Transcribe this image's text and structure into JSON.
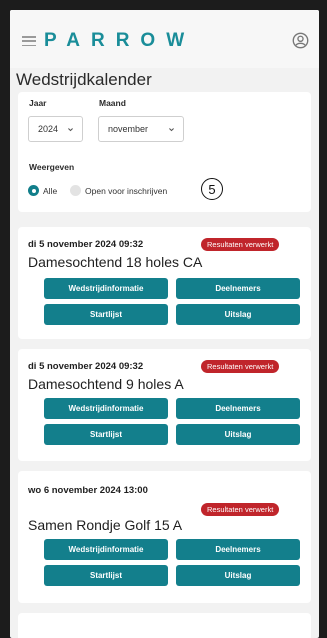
{
  "app": {
    "logo": "PARROW"
  },
  "page": {
    "title": "Wedstrijdkalender"
  },
  "filters": {
    "year_label": "Jaar",
    "year_value": "2024",
    "month_label": "Maand",
    "month_value": "november",
    "view_label": "Weergeven",
    "option_all": "Alle",
    "option_open": "Open voor inschrijven",
    "step_marker": "5"
  },
  "events": [
    {
      "date": "di 5 november 2024 09:32",
      "title": "Damesochtend 18 holes CA",
      "status": "Resultaten verwerkt",
      "buttons": [
        "Wedstrijdinformatie",
        "Deelnemers",
        "Startlijst",
        "Uitslag"
      ]
    },
    {
      "date": "di 5 november 2024 09:32",
      "title": "Damesochtend 9 holes A",
      "status": "Resultaten verwerkt",
      "buttons": [
        "Wedstrijdinformatie",
        "Deelnemers",
        "Startlijst",
        "Uitslag"
      ]
    },
    {
      "date": "wo 6 november 2024 13:00",
      "title": "Samen Rondje Golf 15 A",
      "status": "Resultaten verwerkt",
      "buttons": [
        "Wedstrijdinformatie",
        "Deelnemers",
        "Startlijst",
        "Uitslag"
      ]
    }
  ],
  "colors": {
    "brand": "#1a8d99",
    "button": "#137f8c",
    "status": "#c0252b",
    "radio_active": "#117e8a"
  }
}
